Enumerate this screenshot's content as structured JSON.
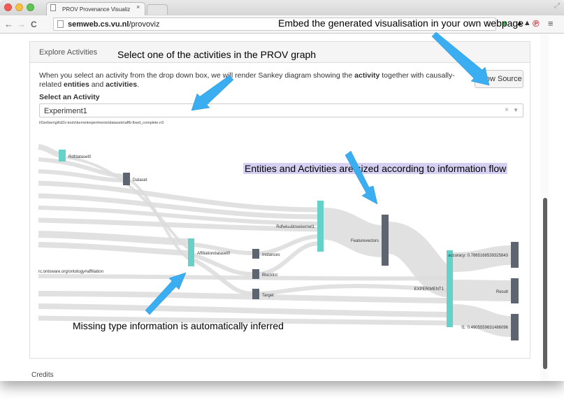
{
  "browser": {
    "tab_title": "PROV Provenance Visualiz",
    "tab_close": "×",
    "url_host": "semweb.cs.vu.nl",
    "url_path": "/provoviz",
    "back": "←",
    "forward": "→",
    "reload": "C"
  },
  "panel": {
    "title": "Explore Activities",
    "description_parts": [
      "When you select an activity from the drop down box, we will render Sankey diagram showing the ",
      "activity",
      " together with causally-related ",
      "entities",
      " and ",
      "activities",
      "."
    ],
    "show_source_label": "Show Source",
    "select_label": "Select an Activity",
    "select_value": "Experiment1",
    "select_clear": "×",
    "select_arrow": "▼",
    "file_path": "l/Gerben\\git\\d2s-tools\\kernelexperiments\\datasets\\affb-fixed_complete.n3"
  },
  "sankey": {
    "nodes": [
      {
        "label": "Rdfdataset0",
        "color": "#64d2c8"
      },
      {
        "label": "Dataset",
        "color": "#5d6670"
      },
      {
        "label": "Affiliationdataset0",
        "color": "#64d2c8"
      },
      {
        "label": "Instances",
        "color": "#5d6670"
      },
      {
        "label": "Blacklist",
        "color": "#5d6670"
      },
      {
        "label": "Target",
        "color": "#5d6670"
      },
      {
        "label": "Rdfwlsubtreekernel1",
        "color": "#64d2c8"
      },
      {
        "label": "Featurevectors",
        "color": "#5d6670"
      },
      {
        "label": "EXPERIMENT1",
        "color": "#64d2c8"
      },
      {
        "label": "accuracy: 0.7865168539325843",
        "color": "#5d6670"
      },
      {
        "label": "Result",
        "color": "#5d6670"
      },
      {
        "label": "f1: 0.4905559631486096",
        "color": "#5d6670"
      }
    ],
    "side_label": "rc.ontoware.org/ontology#affiliation",
    "link_color": "#dcdcdc"
  },
  "footer": {
    "credits": "Credits"
  },
  "annotations": {
    "embed": "Embed the generated visualisation in your own webpage",
    "select": "Select one of the activities in the PROV graph",
    "sized": "Entities and Activities are sized according to information flow",
    "missing": "Missing type information is automatically inferred",
    "arrow_color": "#3aaef0"
  }
}
